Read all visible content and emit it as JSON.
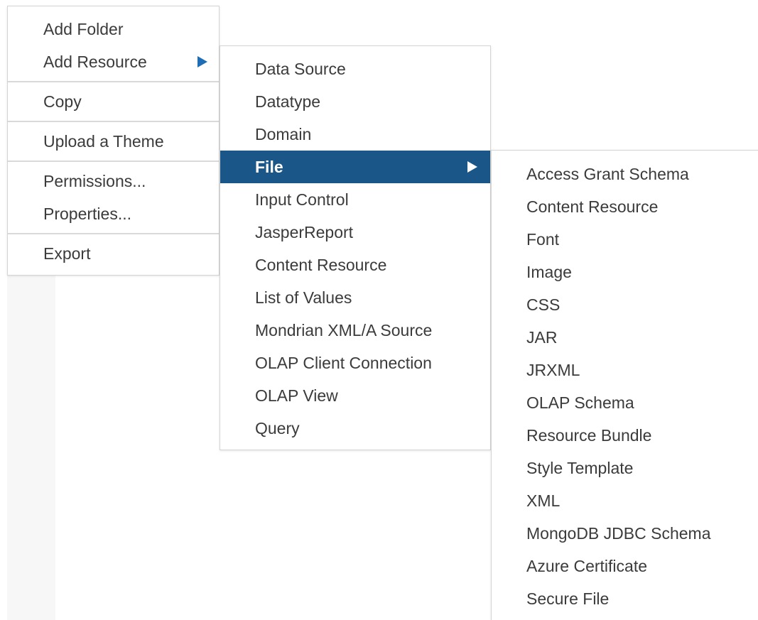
{
  "menu": {
    "items": [
      {
        "label": "Add Folder"
      },
      {
        "label": "Add Resource"
      },
      {
        "label": "Copy"
      },
      {
        "label": "Upload a Theme"
      },
      {
        "label": "Permissions..."
      },
      {
        "label": "Properties..."
      },
      {
        "label": "Export"
      }
    ]
  },
  "submenu_add_resource": {
    "items": [
      {
        "label": "Data Source"
      },
      {
        "label": "Datatype"
      },
      {
        "label": "Domain"
      },
      {
        "label": "File"
      },
      {
        "label": "Input Control"
      },
      {
        "label": "JasperReport"
      },
      {
        "label": "Content Resource"
      },
      {
        "label": "List of Values"
      },
      {
        "label": "Mondrian XML/A Source"
      },
      {
        "label": "OLAP Client Connection"
      },
      {
        "label": "OLAP View"
      },
      {
        "label": "Query"
      }
    ],
    "selected": "File"
  },
  "submenu_file": {
    "items": [
      {
        "label": "Access Grant Schema"
      },
      {
        "label": "Content Resource"
      },
      {
        "label": "Font"
      },
      {
        "label": "Image"
      },
      {
        "label": "CSS"
      },
      {
        "label": "JAR"
      },
      {
        "label": "JRXML"
      },
      {
        "label": "OLAP Schema"
      },
      {
        "label": "Resource Bundle"
      },
      {
        "label": "Style Template"
      },
      {
        "label": "XML"
      },
      {
        "label": "MongoDB JDBC Schema"
      },
      {
        "label": "Azure Certificate"
      },
      {
        "label": "Secure File"
      }
    ]
  },
  "colors": {
    "selected_bg": "#1b5688",
    "arrow": "#1f6eb5",
    "text": "#3b3b3b",
    "separator": "#d9d9d9"
  },
  "icons": {
    "submenu_arrow": "triangle-right-icon"
  }
}
